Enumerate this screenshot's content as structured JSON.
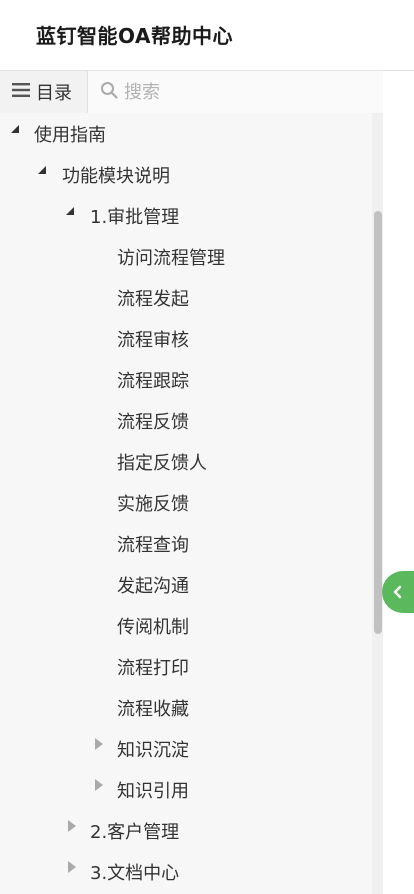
{
  "header": {
    "title": "蓝钉智能OA帮助中心"
  },
  "tabs": {
    "toc_label": "目录",
    "search_placeholder": "搜索"
  },
  "tree": [
    {
      "label": "使用指南",
      "expander": "open"
    },
    {
      "label": "功能模块说明",
      "expander": "open"
    },
    {
      "label": "1.审批管理",
      "expander": "open"
    },
    {
      "label": "访问流程管理",
      "expander": "none"
    },
    {
      "label": "流程发起",
      "expander": "none"
    },
    {
      "label": "流程审核",
      "expander": "none"
    },
    {
      "label": "流程跟踪",
      "expander": "none"
    },
    {
      "label": "流程反馈",
      "expander": "none"
    },
    {
      "label": "指定反馈人",
      "expander": "none"
    },
    {
      "label": "实施反馈",
      "expander": "none"
    },
    {
      "label": "流程查询",
      "expander": "none"
    },
    {
      "label": "发起沟通",
      "expander": "none"
    },
    {
      "label": "传阅机制",
      "expander": "none"
    },
    {
      "label": "流程打印",
      "expander": "none"
    },
    {
      "label": "流程收藏",
      "expander": "none"
    },
    {
      "label": "知识沉淀",
      "expander": "closed"
    },
    {
      "label": "知识引用",
      "expander": "closed"
    },
    {
      "label": "2.客户管理",
      "expander": "closed"
    },
    {
      "label": "3.文档中心",
      "expander": "closed"
    }
  ],
  "icons": {
    "toc": "list-icon",
    "search": "search-icon",
    "collapse": "chevron-left-icon"
  },
  "colors": {
    "accent": "#5cb85c",
    "text": "#333333",
    "panel_bg": "#f7f7f7"
  }
}
